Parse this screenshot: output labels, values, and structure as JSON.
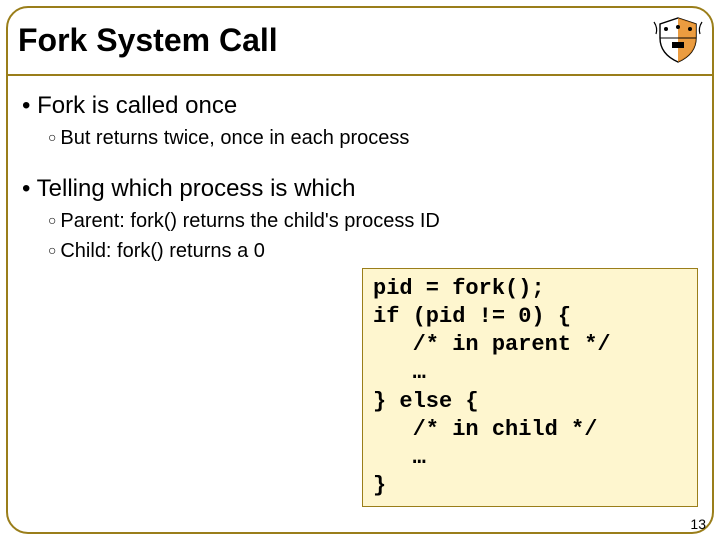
{
  "title": "Fork System Call",
  "bullets": {
    "a": "Fork is called once",
    "a1": "But returns twice, once in each process",
    "b": "Telling which process is which",
    "b1": "Parent: fork() returns the child's process ID",
    "b2": "Child: fork() returns a 0"
  },
  "code": "pid = fork();\nif (pid != 0) {\n   /* in parent */\n   …\n} else {\n   /* in child */\n   …\n}",
  "page_number": "13",
  "logo_name": "princeton-shield"
}
